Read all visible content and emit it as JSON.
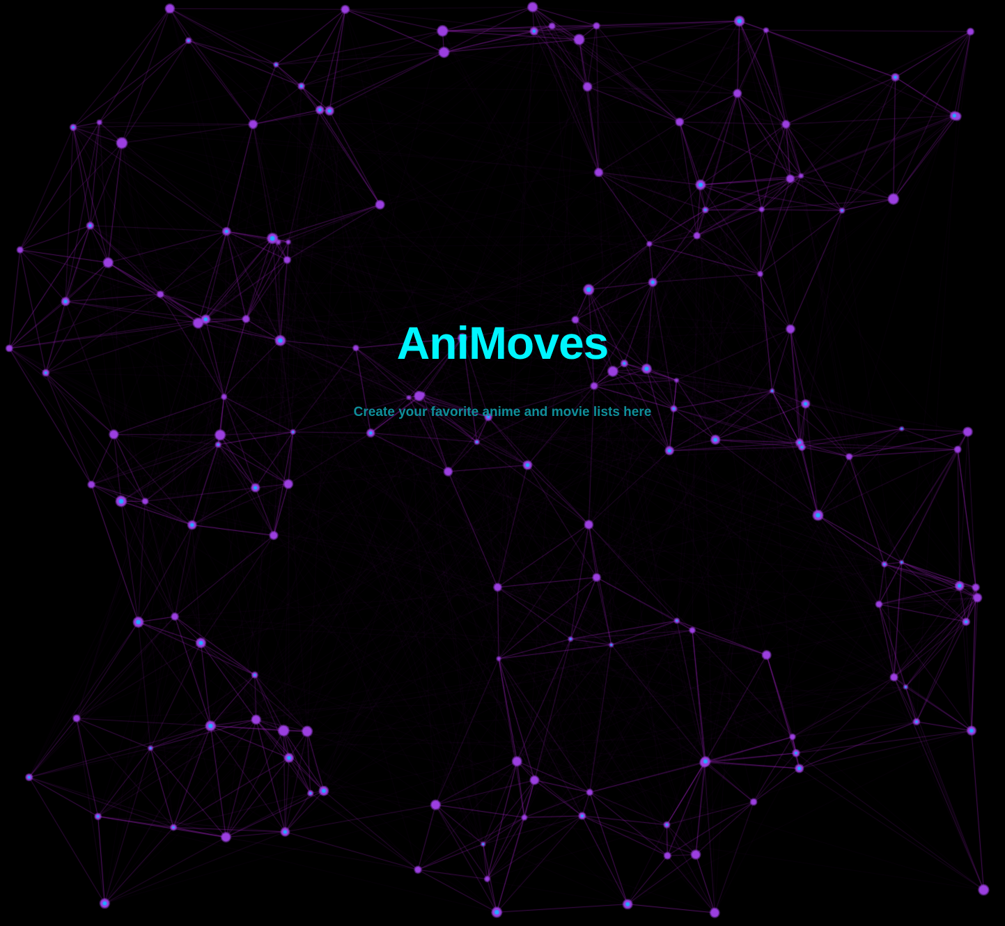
{
  "app": {
    "title": "AniMoves",
    "subtitle": "Create your favorite anime and movie lists here"
  },
  "colors": {
    "background": "#000000",
    "title": "#00f5ff",
    "subtitle": "#0f8f9a",
    "edge": "#b026d6",
    "node_fill": "#9b3fe0",
    "node_glow": "#22a9ff"
  },
  "background_visual": {
    "type": "particle-network",
    "node_count": 160
  }
}
